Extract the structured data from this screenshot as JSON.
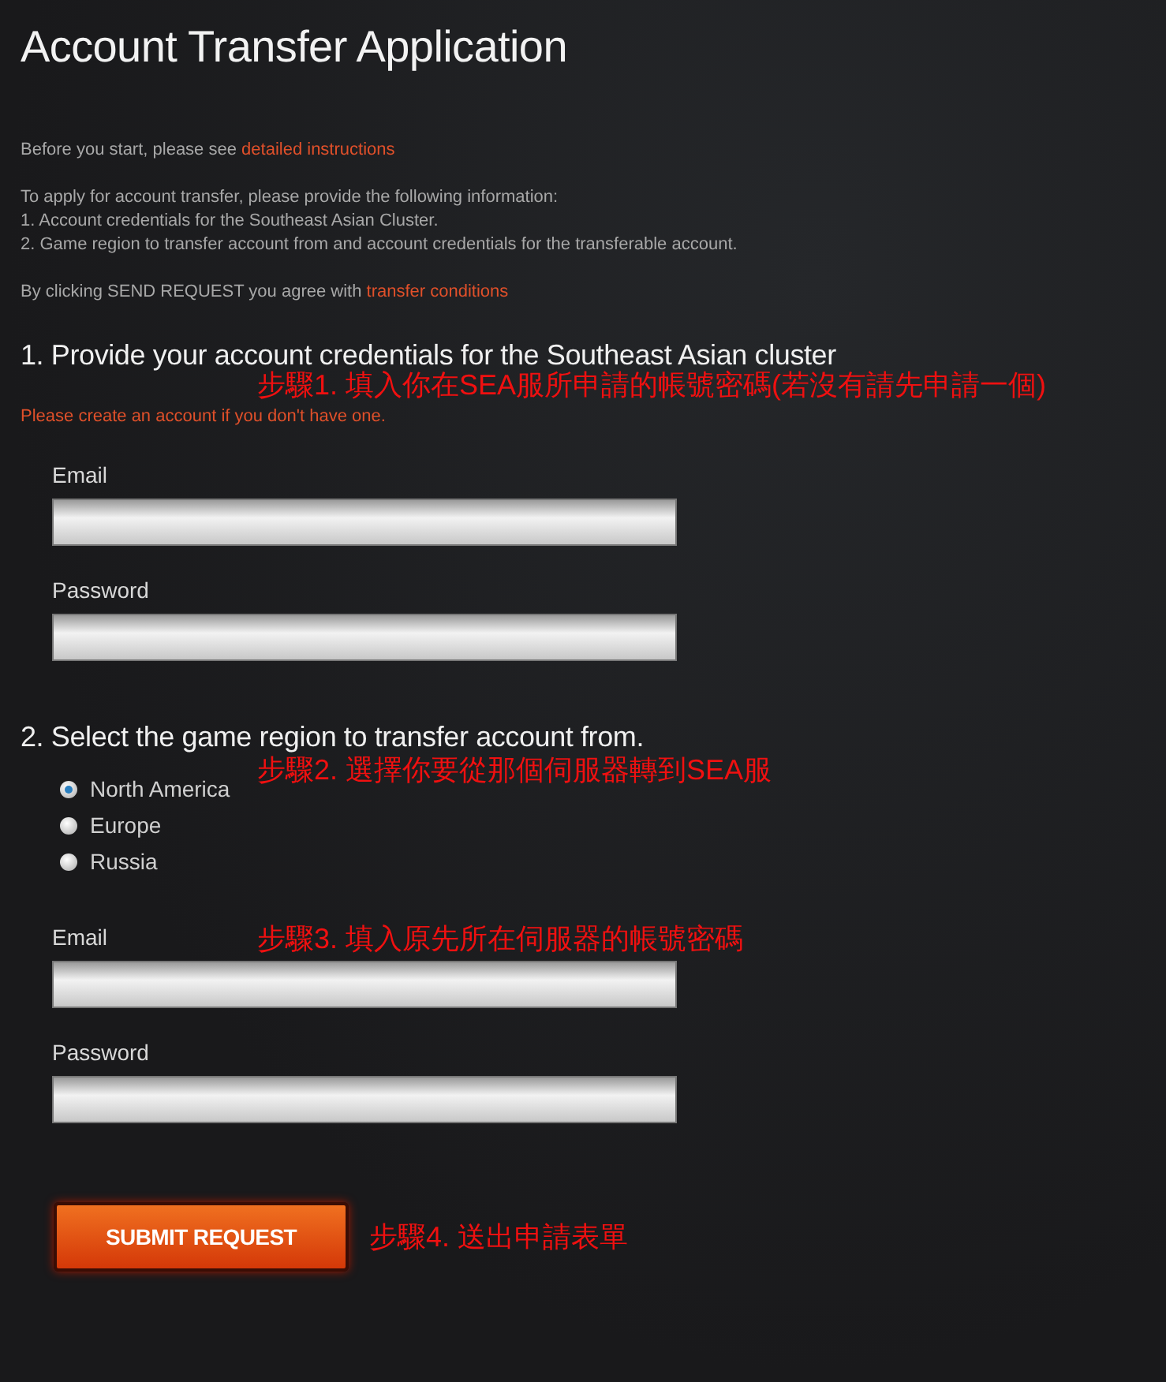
{
  "title": "Account Transfer Application",
  "intro": [
    {
      "text": "Before you start, please see ",
      "link": "detailed instructions"
    },
    {
      "lines": [
        "To apply for account transfer, please provide the following information:",
        "1. Account credentials for the Southeast Asian Cluster.",
        "2. Game region to transfer account from and account credentials for the transferable account."
      ]
    },
    {
      "text": "By clicking SEND REQUEST you agree with ",
      "link": "transfer conditions"
    }
  ],
  "section1": {
    "heading": "1. Provide your account credentials for the Southeast Asian cluster",
    "annotation": "步驟1. 填入你在SEA服所申請的帳號密碼(若沒有請先申請一個)",
    "note": "Please create an account if you don't have one.",
    "fields": [
      {
        "label": "Email"
      },
      {
        "label": "Password"
      }
    ]
  },
  "section2": {
    "heading": "2. Select the game region to transfer account from.",
    "annotation": "步驟2. 選擇你要從那個伺服器轉到SEA服",
    "regions": [
      {
        "label": "North America",
        "selected": true
      },
      {
        "label": "Europe",
        "selected": false
      },
      {
        "label": "Russia",
        "selected": false
      }
    ],
    "fields_annotation": "步驟3. 填入原先所在伺服器的帳號密碼",
    "fields": [
      {
        "label": "Email"
      },
      {
        "label": "Password"
      }
    ]
  },
  "submit": {
    "label": "SUBMIT REQUEST",
    "annotation": "步驟4. 送出申請表單"
  }
}
